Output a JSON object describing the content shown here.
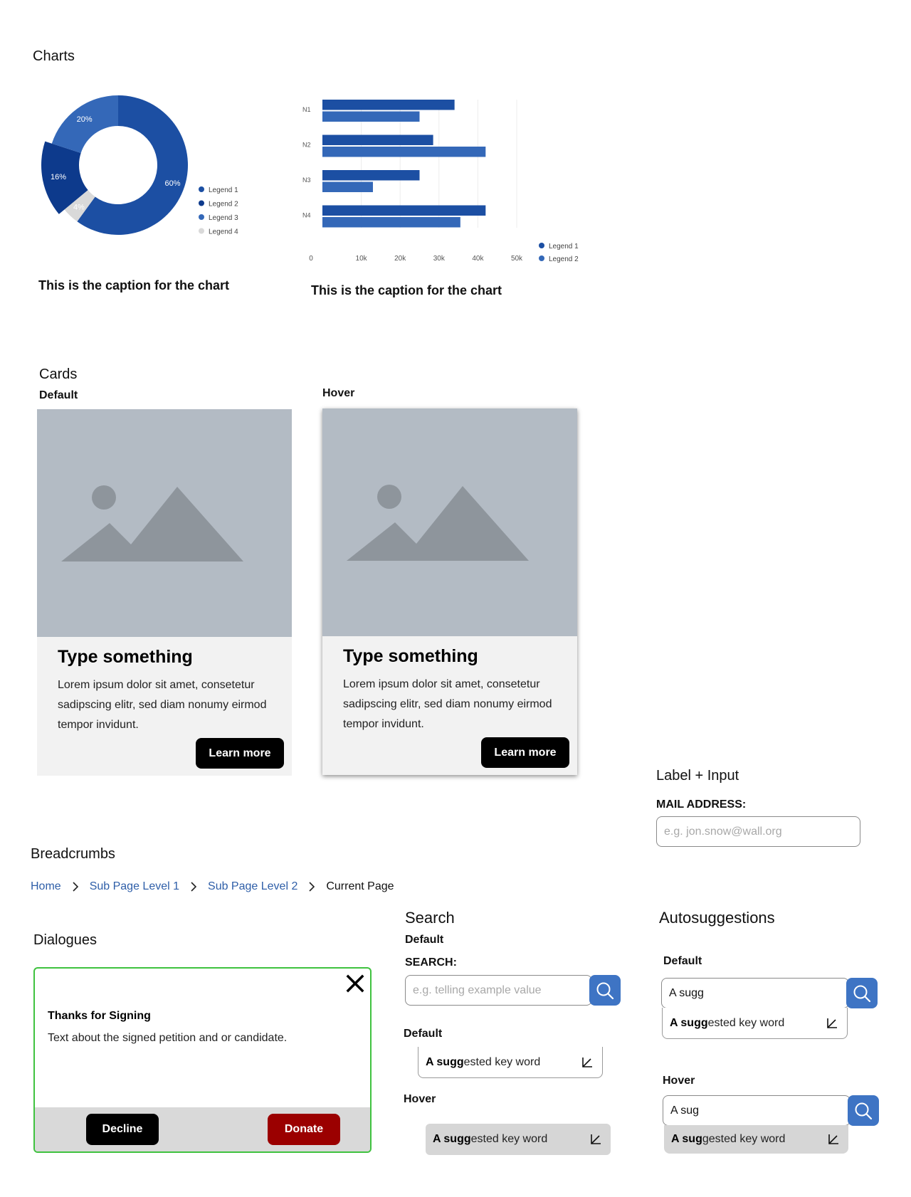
{
  "sections": {
    "charts": "Charts",
    "cards": "Cards",
    "breadcrumbs": "Breadcrumbs",
    "dialogues": "Dialogues",
    "search": "Search",
    "autosuggestions": "Autosuggestions",
    "label_input": "Label + Input"
  },
  "chart_data": [
    {
      "type": "pie",
      "variant": "donut",
      "title": "",
      "caption": "This is the caption for the chart",
      "slices": [
        {
          "label": "Legend 1",
          "value": 60,
          "display": "60%",
          "color": "#1c4fa3"
        },
        {
          "label": "Legend 2",
          "value": 4,
          "display": "4%",
          "color": "#d9d9d9"
        },
        {
          "label": "Legend 3",
          "value": 16,
          "display": "16%",
          "color": "#0d3a8c"
        },
        {
          "label": "Legend 4",
          "value": 20,
          "display": "20%",
          "color": "#3468b8"
        }
      ],
      "legend": [
        {
          "label": "Legend 1",
          "color": "#1c4fa3"
        },
        {
          "label": "Legend 2",
          "color": "#0d3a8c"
        },
        {
          "label": "Legend 3",
          "color": "#3468b8"
        },
        {
          "label": "Legend 4",
          "color": "#d9d9d9"
        }
      ],
      "legend_position": "right"
    },
    {
      "type": "bar",
      "orientation": "horizontal",
      "title": "",
      "caption": "This is the caption for the chart",
      "categories": [
        "N1",
        "N2",
        "N3",
        "N4"
      ],
      "series": [
        {
          "name": "Legend 1",
          "values": [
            34000,
            28500,
            25000,
            42000
          ],
          "color": "#1c4fa3"
        },
        {
          "name": "Legend 2",
          "values": [
            25000,
            42000,
            13000,
            35500
          ],
          "color": "#3468b8"
        }
      ],
      "xlim": [
        0,
        50000
      ],
      "xticks": [
        "0",
        "10k",
        "20k",
        "30k",
        "40k",
        "50k"
      ],
      "grid": true,
      "legend_position": "bottom-right"
    }
  ],
  "cards": {
    "default_label": "Default",
    "hover_label": "Hover",
    "items": [
      {
        "title": "Type something",
        "body": "Lorem ipsum dolor sit amet, consetetur sadipscing elitr, sed diam nonumy eirmod tempor invidunt.",
        "button": "Learn more"
      },
      {
        "title": "Type something",
        "body": "Lorem ipsum dolor sit amet, consetetur sadipscing elitr, sed diam nonumy eirmod tempor invidunt.",
        "button": "Learn more"
      }
    ]
  },
  "label_input": {
    "label": "MAIL ADDRESS:",
    "placeholder": "e.g. jon.snow@wall.org"
  },
  "breadcrumbs": {
    "items": [
      "Home",
      "Sub Page Level 1",
      "Sub Page Level 2"
    ],
    "current": "Current Page"
  },
  "dialog": {
    "title": "Thanks for Signing",
    "text": "Text about the signed petition and or candidate.",
    "decline": "Decline",
    "donate": "Donate"
  },
  "search": {
    "state_default": "Default",
    "label": "SEARCH:",
    "placeholder": "e.g. telling example value",
    "sugg_default_label": "Default",
    "sugg_hover_label": "Hover",
    "sugg_bold": "A sugg",
    "sugg_rest": "ested key word"
  },
  "autosuggestions": {
    "default_label": "Default",
    "default_value": "A sugg",
    "default_bold": "A sugg",
    "default_rest": "ested key word",
    "hover_label": "Hover",
    "hover_value": "A sug",
    "hover_bold": "A sug",
    "hover_rest": "gested key word"
  }
}
